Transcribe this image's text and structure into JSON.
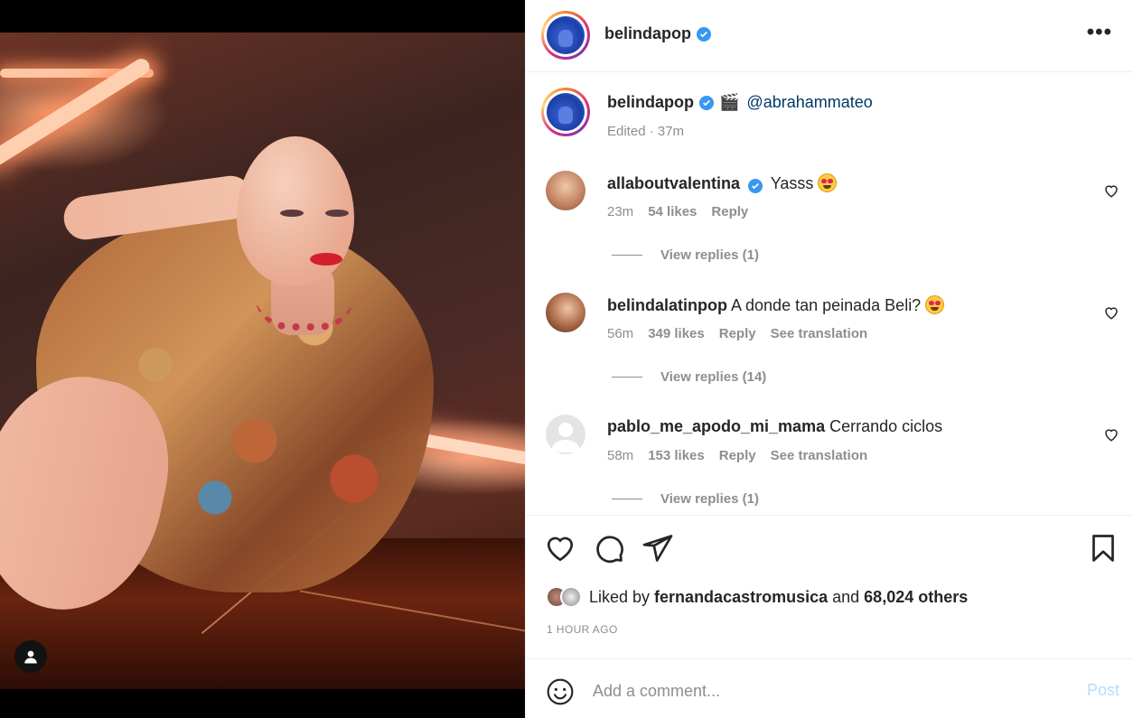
{
  "post": {
    "author": "belindapop",
    "verified": true,
    "caption_mention": "@abrahammateo",
    "caption_emoji": "🎬",
    "caption_meta": "Edited · 37m",
    "more_icon": "more-horizontal-icon"
  },
  "comments": [
    {
      "username": "allaboutvalentina",
      "verified": true,
      "text": "Yasss",
      "time": "23m",
      "likes": "54 likes",
      "reply": "Reply",
      "translation": "",
      "view_replies": "View replies (1)"
    },
    {
      "username": "belindalatinpop",
      "verified": false,
      "text": "A donde tan peinada Beli?",
      "time": "56m",
      "likes": "349 likes",
      "reply": "Reply",
      "translation": "See translation",
      "view_replies": "View replies (14)"
    },
    {
      "username": "pablo_me_apodo_mi_mama",
      "verified": false,
      "text": "Cerrando ciclos",
      "time": "58m",
      "likes": "153 likes",
      "reply": "Reply",
      "translation": "See translation",
      "view_replies": "View replies (1)"
    }
  ],
  "actions": {
    "liked_by_prefix": "Liked by",
    "liked_by_user": "fernandacastromusica",
    "liked_by_and": "and",
    "liked_by_others": "68,024 others",
    "time_ago": "1 HOUR AGO"
  },
  "add_comment": {
    "placeholder": "Add a comment...",
    "post_label": "Post"
  },
  "colors": {
    "verified": "#3897f0",
    "post_disabled": "#b2dffc",
    "mention": "#00376b",
    "meta": "#8e8e8e"
  }
}
